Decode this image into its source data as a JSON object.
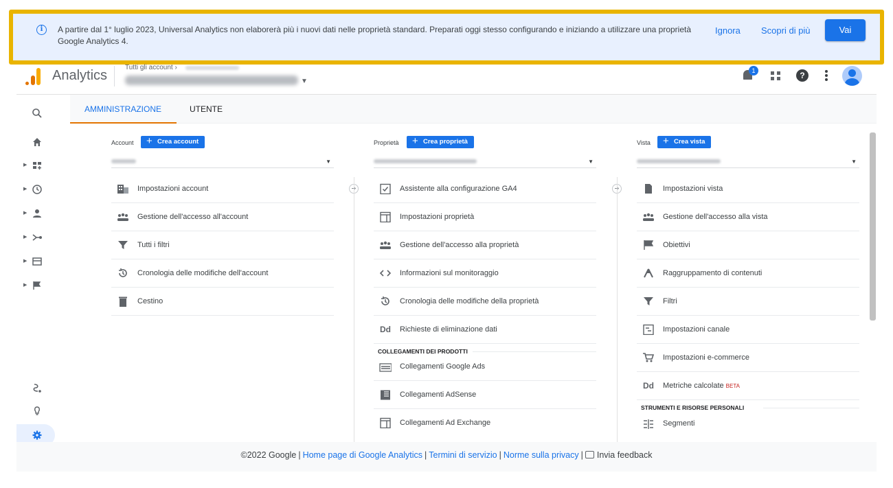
{
  "banner": {
    "message": "A partire dal 1° luglio 2023, Universal Analytics non elaborerà più i nuovi dati nelle proprietà standard. Preparati oggi stesso configurando e iniziando a utilizzare una proprietà Google Analytics 4.",
    "ignore_label": "Ignora",
    "learn_more_label": "Scopri di più",
    "go_label": "Vai",
    "highlight_color": "#e9b400"
  },
  "header": {
    "app_name": "Analytics",
    "breadcrumb": "Tutti gli account ›",
    "notification_count": "1"
  },
  "tabs": {
    "admin": "AMMINISTRAZIONE",
    "user": "UTENTE"
  },
  "columns": {
    "account": {
      "label": "Account",
      "create_label": "Crea account",
      "items": [
        "Impostazioni account",
        "Gestione dell'accesso all'account",
        "Tutti i filtri",
        "Cronologia delle modifiche dell'account",
        "Cestino"
      ]
    },
    "property": {
      "label": "Proprietà",
      "create_label": "Crea proprietà",
      "items": [
        "Assistente alla configurazione GA4",
        "Impostazioni proprietà",
        "Gestione dell'accesso alla proprietà",
        "Informazioni sul monitoraggio",
        "Cronologia delle modifiche della proprietà",
        "Richieste di eliminazione dati"
      ],
      "section_title": "COLLEGAMENTI DEI PRODOTTI",
      "links": [
        "Collegamenti Google Ads",
        "Collegamenti AdSense",
        "Collegamenti Ad Exchange"
      ]
    },
    "view": {
      "label": "Vista",
      "create_label": "Crea vista",
      "items": [
        "Impostazioni vista",
        "Gestione dell'accesso alla vista",
        "Obiettivi",
        "Raggruppamento di contenuti",
        "Filtri",
        "Impostazioni canale",
        "Impostazioni e-commerce",
        "Metriche calcolate"
      ],
      "beta_label": "BETA",
      "section_title": "STRUMENTI E RISORSE PERSONALI",
      "tools": [
        "Segmenti"
      ]
    }
  },
  "footer": {
    "copyright": "©2022 Google",
    "home_link": "Home page di Google Analytics",
    "terms_link": "Termini di servizio",
    "privacy_link": "Norme sulla privacy",
    "feedback": "Invia feedback"
  },
  "colors": {
    "accent": "#1a73e8",
    "tab_underline": "#e37400"
  }
}
